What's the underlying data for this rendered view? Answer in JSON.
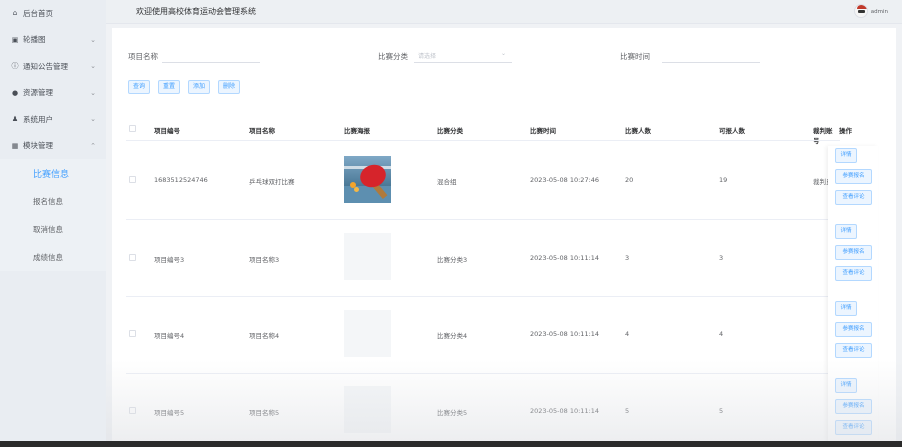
{
  "header": {
    "title": "欢迎使用高校体育运动会管理系统",
    "user": "admin"
  },
  "sidebar": {
    "items": [
      {
        "icon": "home-icon",
        "label": "后台首页",
        "has_chevron": false
      },
      {
        "icon": "image-icon",
        "label": "轮播图",
        "has_chevron": true
      },
      {
        "icon": "info-icon",
        "label": "通知公告管理",
        "has_chevron": true
      },
      {
        "icon": "location-icon",
        "label": "资源管理",
        "has_chevron": true
      },
      {
        "icon": "user-icon",
        "label": "系统用户",
        "has_chevron": true
      },
      {
        "icon": "grid-icon",
        "label": "模块管理",
        "has_chevron": true,
        "expanded": true
      }
    ],
    "submenu": [
      {
        "label": "比赛信息",
        "active": true
      },
      {
        "label": "报名信息",
        "active": false
      },
      {
        "label": "取消信息",
        "active": false
      },
      {
        "label": "成绩信息",
        "active": false
      }
    ]
  },
  "filters": {
    "name_label": "项目名称",
    "category_label": "比赛分类",
    "category_placeholder": "请选择",
    "time_label": "比赛时间"
  },
  "buttons": {
    "query": "查询",
    "reset": "重置",
    "add": "添加",
    "delete": "删除"
  },
  "table": {
    "columns": [
      "项目编号",
      "项目名称",
      "比赛海报",
      "比赛分类",
      "比赛时间",
      "比赛人数",
      "可报人数",
      "裁判账号",
      "操作"
    ],
    "rows": [
      {
        "code": "1683512524746",
        "name": "乒乓球双打比赛",
        "poster": "photo",
        "category": "混合组",
        "time": "2023-05-08 10:27:46",
        "count": "20",
        "available": "19",
        "referee": "裁判员"
      },
      {
        "code": "项目编号3",
        "name": "项目名称3",
        "poster": "blank",
        "category": "比赛分类3",
        "time": "2023-05-08 10:11:14",
        "count": "3",
        "available": "3",
        "referee": ""
      },
      {
        "code": "项目编号4",
        "name": "项目名称4",
        "poster": "blank",
        "category": "比赛分类4",
        "time": "2023-05-08 10:11:14",
        "count": "4",
        "available": "4",
        "referee": ""
      },
      {
        "code": "项目编号5",
        "name": "项目名称5",
        "poster": "blank",
        "category": "比赛分类5",
        "time": "2023-05-08 10:11:14",
        "count": "5",
        "available": "5",
        "referee": ""
      }
    ],
    "row_actions": [
      "详情",
      "参赛报名",
      "查看评论"
    ]
  },
  "colors": {
    "accent": "#409eff",
    "sidebar_bg": "#e9edf2"
  }
}
